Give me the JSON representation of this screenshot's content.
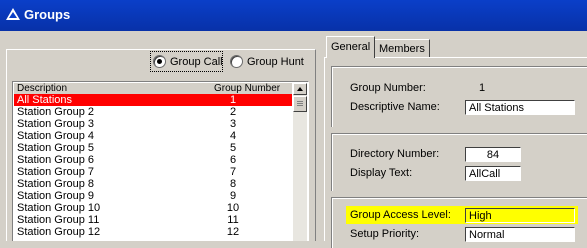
{
  "window": {
    "title": "Groups"
  },
  "group_type": {
    "group_call": "Group Call",
    "group_hunt": "Group Hunt",
    "selected": "group_call"
  },
  "list": {
    "headers": {
      "description": "Description",
      "group_number": "Group Number"
    },
    "rows": [
      {
        "description": "All Stations",
        "number": "1",
        "selected": true
      },
      {
        "description": "Station Group 2",
        "number": "2"
      },
      {
        "description": "Station Group 3",
        "number": "3"
      },
      {
        "description": "Station Group 4",
        "number": "4"
      },
      {
        "description": "Station Group 5",
        "number": "5"
      },
      {
        "description": "Station Group 6",
        "number": "6"
      },
      {
        "description": "Station Group 7",
        "number": "7"
      },
      {
        "description": "Station Group 8",
        "number": "8"
      },
      {
        "description": "Station Group 9",
        "number": "9"
      },
      {
        "description": "Station Group 10",
        "number": "10"
      },
      {
        "description": "Station Group 11",
        "number": "11"
      },
      {
        "description": "Station Group 12",
        "number": "12"
      }
    ]
  },
  "tabs": {
    "general": "General",
    "members": "Members",
    "active": "general"
  },
  "general": {
    "group_number_label": "Group Number:",
    "group_number_value": "1",
    "descriptive_name_label": "Descriptive Name:",
    "descriptive_name_value": "All Stations",
    "directory_number_label": "Directory Number:",
    "directory_number_value": "84",
    "display_text_label": "Display Text:",
    "display_text_value": "AllCall",
    "group_access_level_label": "Group Access Level:",
    "group_access_level_value": "High",
    "setup_priority_label": "Setup Priority:",
    "setup_priority_value": "Normal"
  },
  "colors": {
    "title_bar": "#0a3fc9",
    "selection": "#ff0000",
    "highlight": "#ffff00",
    "face": "#d4d0c8"
  }
}
